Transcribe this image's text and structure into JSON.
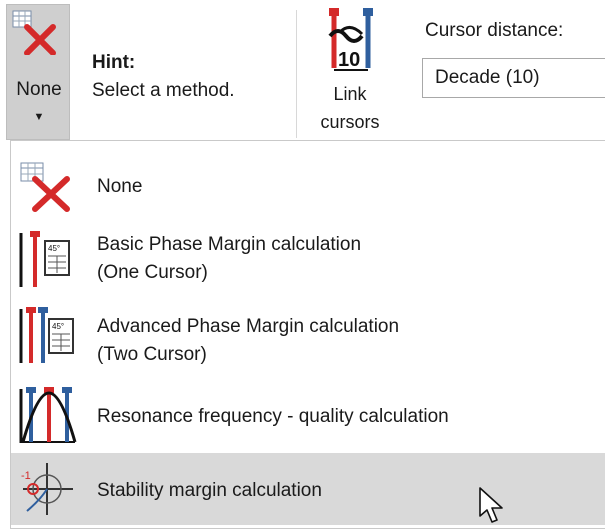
{
  "ribbon": {
    "method_button": {
      "label": "None",
      "icon": "none-method-icon"
    },
    "hint": {
      "title": "Hint:",
      "text": "Select a method."
    },
    "link_button": {
      "line1": "Link",
      "line2": "cursors",
      "icon": "link-cursors-icon"
    },
    "cursor_distance": {
      "label": "Cursor distance:",
      "value": "Decade (10)"
    }
  },
  "dropdown": {
    "items": [
      {
        "label": "None",
        "icon": "none-method-icon"
      },
      {
        "label": "Basic Phase Margin calculation",
        "label2": "(One Cursor)",
        "icon": "one-cursor-icon"
      },
      {
        "label": "Advanced Phase Margin calculation",
        "label2": "(Two Cursor)",
        "icon": "two-cursor-icon"
      },
      {
        "label": "Resonance frequency - quality calculation",
        "icon": "resonance-icon"
      },
      {
        "label": "Stability margin calculation",
        "icon": "stability-icon",
        "selected": true
      }
    ]
  },
  "colors": {
    "accent_red": "#d42a2a",
    "accent_blue": "#2f5f9e",
    "selected_bg": "#d9d9d9"
  }
}
